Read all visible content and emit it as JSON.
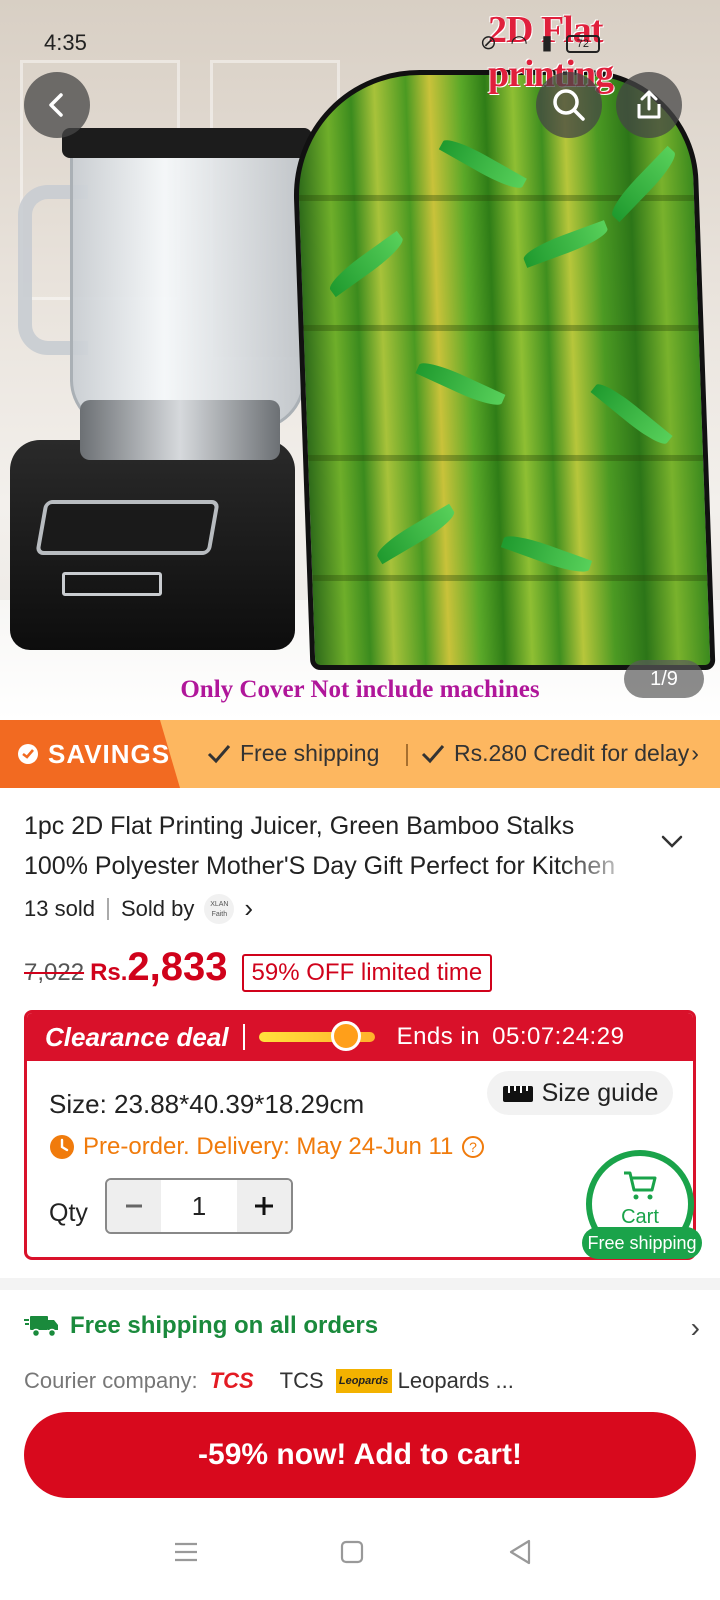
{
  "status_bar": {
    "time": "4:35",
    "battery": "72"
  },
  "hero": {
    "overlay_title": "2D Flat printing",
    "overlay_caption": "Only Cover Not include machines",
    "image_counter": "1/9",
    "icons": {
      "back": "chevron-left-icon",
      "search": "search-icon",
      "share": "share-icon"
    }
  },
  "savings_bar": {
    "tag_label": "SAVINGS",
    "perk_1": "Free shipping",
    "perk_2": "Rs.280 Credit for delay"
  },
  "product": {
    "title": "1pc 2D Flat Printing Juicer, Green Bamboo Stalks 100% Polyester Mother'S Day Gift Perfect for Kitchen",
    "sold": "13 sold",
    "sold_by_label": "Sold by",
    "seller_logo_text": "XLAN Faith",
    "old_price": "7,022",
    "currency": "Rs.",
    "price": "2,833",
    "discount_badge": "59% OFF limited time"
  },
  "clearance": {
    "title": "Clearance deal",
    "timer_progress": 0.75,
    "ends_label": "Ends in",
    "countdown": "05:07:24:29",
    "size_label": "Size:",
    "size_value": "23.88*40.39*18.29cm",
    "size_guide_label": "Size guide",
    "preorder_text": "Pre-order. Delivery: May 24-Jun 11",
    "qty_label": "Qty",
    "qty_value": "1"
  },
  "cart_fab": {
    "label": "Cart",
    "badge": "Free shipping"
  },
  "shipping": {
    "headline": "Free shipping on all orders",
    "courier_label": "Courier company:",
    "courier_1_logo": "TCS",
    "courier_1": "TCS",
    "courier_2_logo": "Leopards",
    "courier_2": "Leopards ..."
  },
  "cta": {
    "label": "-59% now! Add to cart!"
  },
  "colors": {
    "accent_red": "#d8091d",
    "savings_orange": "#f26a21",
    "savings_bar": "#fdb760",
    "green": "#1aa34a",
    "preorder_orange": "#f07b0c"
  }
}
